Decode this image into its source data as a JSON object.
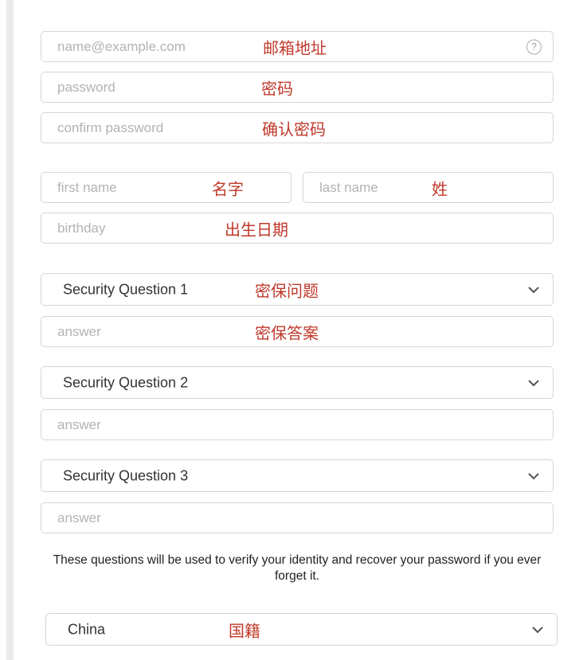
{
  "email": {
    "placeholder": "name@example.com",
    "annotation": "邮箱地址",
    "help_icon": "question-circle-icon",
    "help_glyph": "?"
  },
  "password": {
    "placeholder": "password",
    "annotation": "密码"
  },
  "confirm_password": {
    "placeholder": "confirm password",
    "annotation": "确认密码"
  },
  "first_name": {
    "placeholder": "first name",
    "annotation": "名字"
  },
  "last_name": {
    "placeholder": "last name",
    "annotation": "姓"
  },
  "birthday": {
    "placeholder": "birthday",
    "annotation": "出生日期"
  },
  "security": [
    {
      "question": "Security Question 1",
      "question_annotation": "密保问题",
      "answer_placeholder": "answer",
      "answer_annotation": "密保答案"
    },
    {
      "question": "Security Question 2",
      "answer_placeholder": "answer"
    },
    {
      "question": "Security Question 3",
      "answer_placeholder": "answer"
    }
  ],
  "info_text": "These questions will be used to verify your identity and recover your password if you ever forget it.",
  "country": {
    "value": "China",
    "annotation": "国籍"
  },
  "colors": {
    "annotation": "#c0392b",
    "placeholder": "#b3b3b3",
    "border": "#d6d6d6"
  },
  "icons": {
    "dropdown": "chevron-down-icon",
    "help": "question-circle-icon"
  }
}
